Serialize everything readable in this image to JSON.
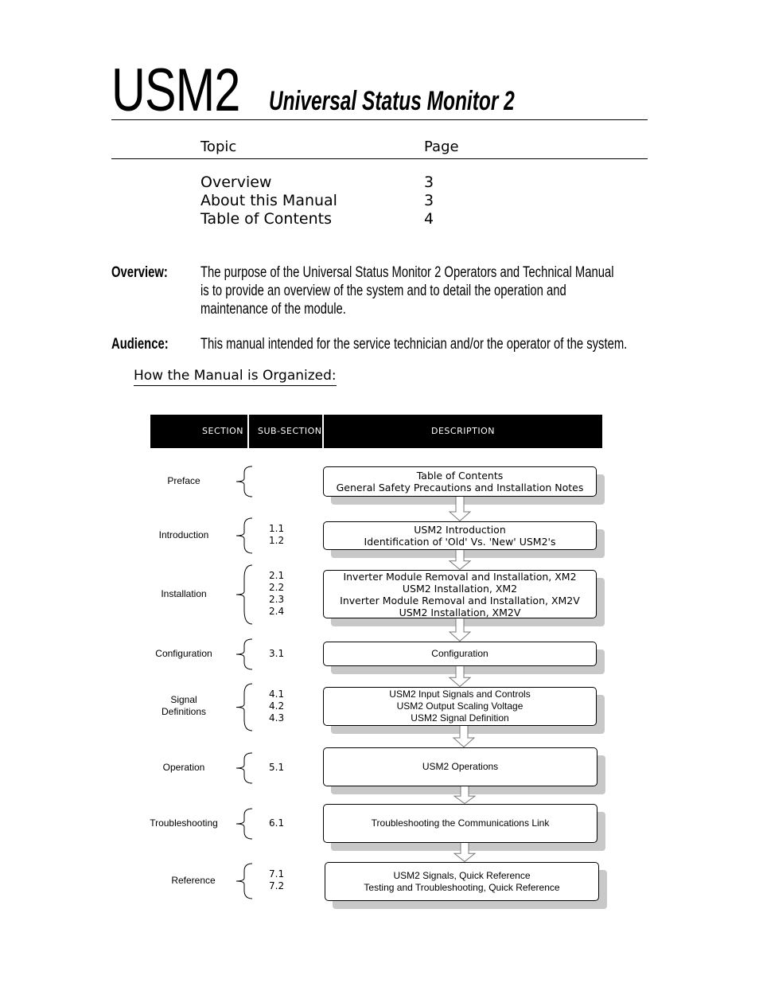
{
  "header": {
    "title_short": "USM2",
    "title_long": "Universal Status Monitor 2"
  },
  "toc": {
    "col_topic": "Topic",
    "col_page": "Page",
    "items": [
      {
        "topic": "Overview",
        "page": "3"
      },
      {
        "topic": "About this Manual",
        "page": "3"
      },
      {
        "topic": "Table of Contents",
        "page": "4"
      }
    ]
  },
  "overview": {
    "label": "Overview:",
    "lines": [
      "The purpose of the Universal Status Monitor 2 Operators and Technical Manual",
      "is to provide an overview of the system and to detail the operation and",
      "maintenance of the module."
    ]
  },
  "audience": {
    "label": "Audience:",
    "text": "This manual intended for the service technician and/or the operator of the system."
  },
  "organization": {
    "heading": "How the Manual is Organized:",
    "columns": {
      "section": "SECTION",
      "subsection": "SUB-SECTION",
      "description": "DESCRIPTION"
    },
    "rows": [
      {
        "section": [
          "Preface"
        ],
        "subsections": [],
        "descriptions": [
          "Table of Contents",
          "General Safety Precautions and Installation Notes"
        ]
      },
      {
        "section": [
          "Introduction"
        ],
        "subsections": [
          "1.1",
          "1.2"
        ],
        "descriptions": [
          "USM2 Introduction",
          "Identification of 'Old' Vs. 'New' USM2's"
        ]
      },
      {
        "section": [
          "Installation"
        ],
        "subsections": [
          "2.1",
          "2.2",
          "2.3",
          "2.4"
        ],
        "descriptions": [
          "Inverter Module Removal and Installation, XM2",
          "USM2 Installation, XM2",
          "Inverter Module Removal and Installation, XM2V",
          "USM2 Installation, XM2V"
        ]
      },
      {
        "section": [
          "Configuration"
        ],
        "subsections": [
          "3.1"
        ],
        "descriptions": [
          "Configuration"
        ]
      },
      {
        "section": [
          "Signal",
          "Definitions"
        ],
        "subsections": [
          "4.1",
          "4.2",
          "4.3"
        ],
        "descriptions": [
          "USM2 Input Signals and Controls",
          "USM2 Output Scaling Voltage",
          "USM2 Signal Definition"
        ]
      },
      {
        "section": [
          "Operation"
        ],
        "subsections": [
          "5.1"
        ],
        "descriptions": [
          "USM2 Operations"
        ]
      },
      {
        "section": [
          "Troubleshooting"
        ],
        "subsections": [
          "6.1"
        ],
        "descriptions": [
          "Troubleshooting the Communications Link"
        ]
      },
      {
        "section": [
          "Reference"
        ],
        "subsections": [
          "7.1",
          "7.2"
        ],
        "descriptions": [
          "USM2 Signals, Quick Reference",
          "Testing and Troubleshooting, Quick Reference"
        ]
      }
    ]
  }
}
